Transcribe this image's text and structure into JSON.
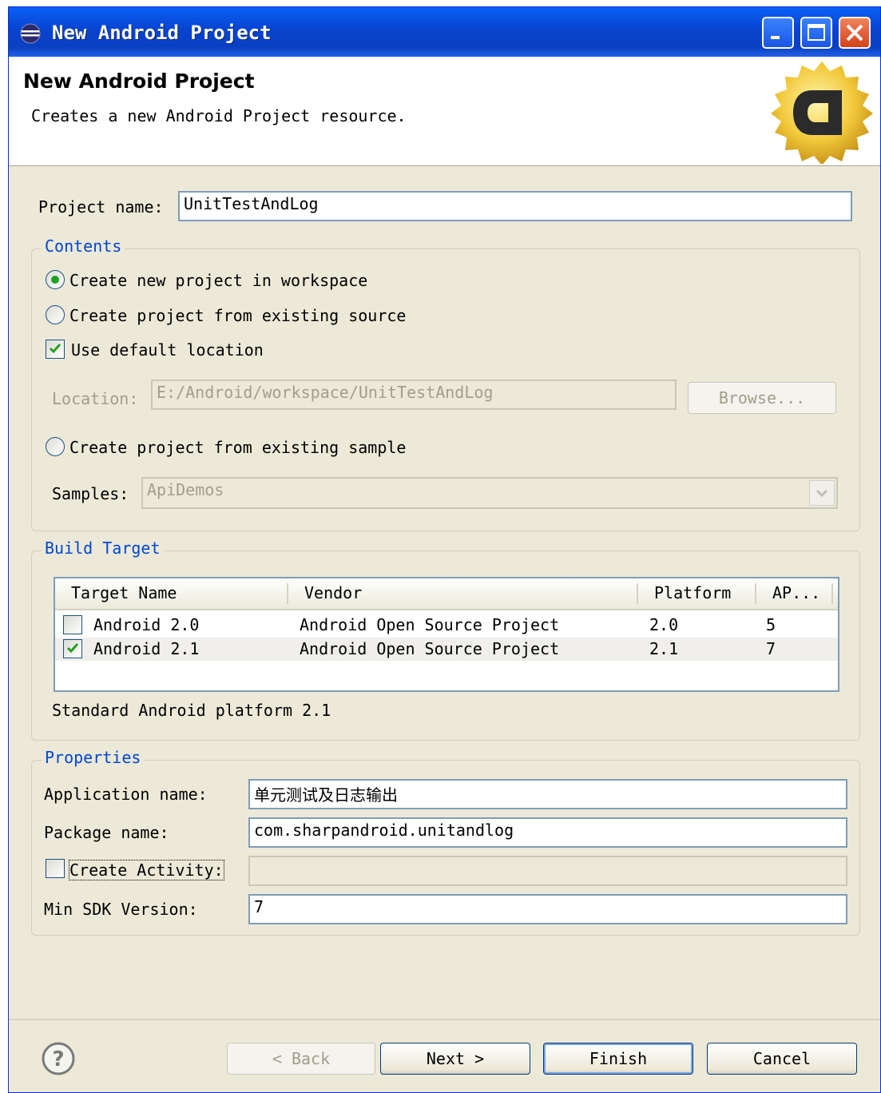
{
  "window": {
    "title": "New Android Project"
  },
  "header": {
    "title": "New Android Project",
    "description": "Creates a new Android Project resource."
  },
  "form": {
    "project_name_label": "Project name:",
    "project_name_value": "UnitTestAndLog"
  },
  "contents": {
    "title": "Contents",
    "radio_new": "Create new project in workspace",
    "radio_existing": "Create project from existing source",
    "use_default_location": "Use default location",
    "location_label": "Location:",
    "location_value": "E:/Android/workspace/UnitTestAndLog",
    "browse_label": "Browse...",
    "radio_sample": "Create project from existing sample",
    "samples_label": "Samples:",
    "samples_value": "ApiDemos"
  },
  "build_target": {
    "title": "Build Target",
    "columns": [
      "Target Name",
      "Vendor",
      "Platform",
      "AP..."
    ],
    "rows": [
      {
        "name": "Android 2.0",
        "vendor": "Android Open Source Project",
        "platform": "2.0",
        "api": "5",
        "checked": false
      },
      {
        "name": "Android 2.1",
        "vendor": "Android Open Source Project",
        "platform": "2.1",
        "api": "7",
        "checked": true
      }
    ],
    "description": "Standard Android platform 2.1"
  },
  "properties": {
    "title": "Properties",
    "app_name_label": "Application name:",
    "app_name_value": "单元测试及日志输出",
    "package_label": "Package name:",
    "package_value": "com.sharpandroid.unitandlog",
    "create_activity_label": "Create Activity:",
    "create_activity_value": "",
    "min_sdk_label": "Min SDK Version:",
    "min_sdk_value": "7"
  },
  "buttons": {
    "back": "< Back",
    "next": "Next >",
    "finish": "Finish",
    "cancel": "Cancel"
  },
  "colors": {
    "titlebar": "#0a4fe0",
    "group_title": "#0046d5",
    "dialog_bg": "#ece9d8"
  }
}
